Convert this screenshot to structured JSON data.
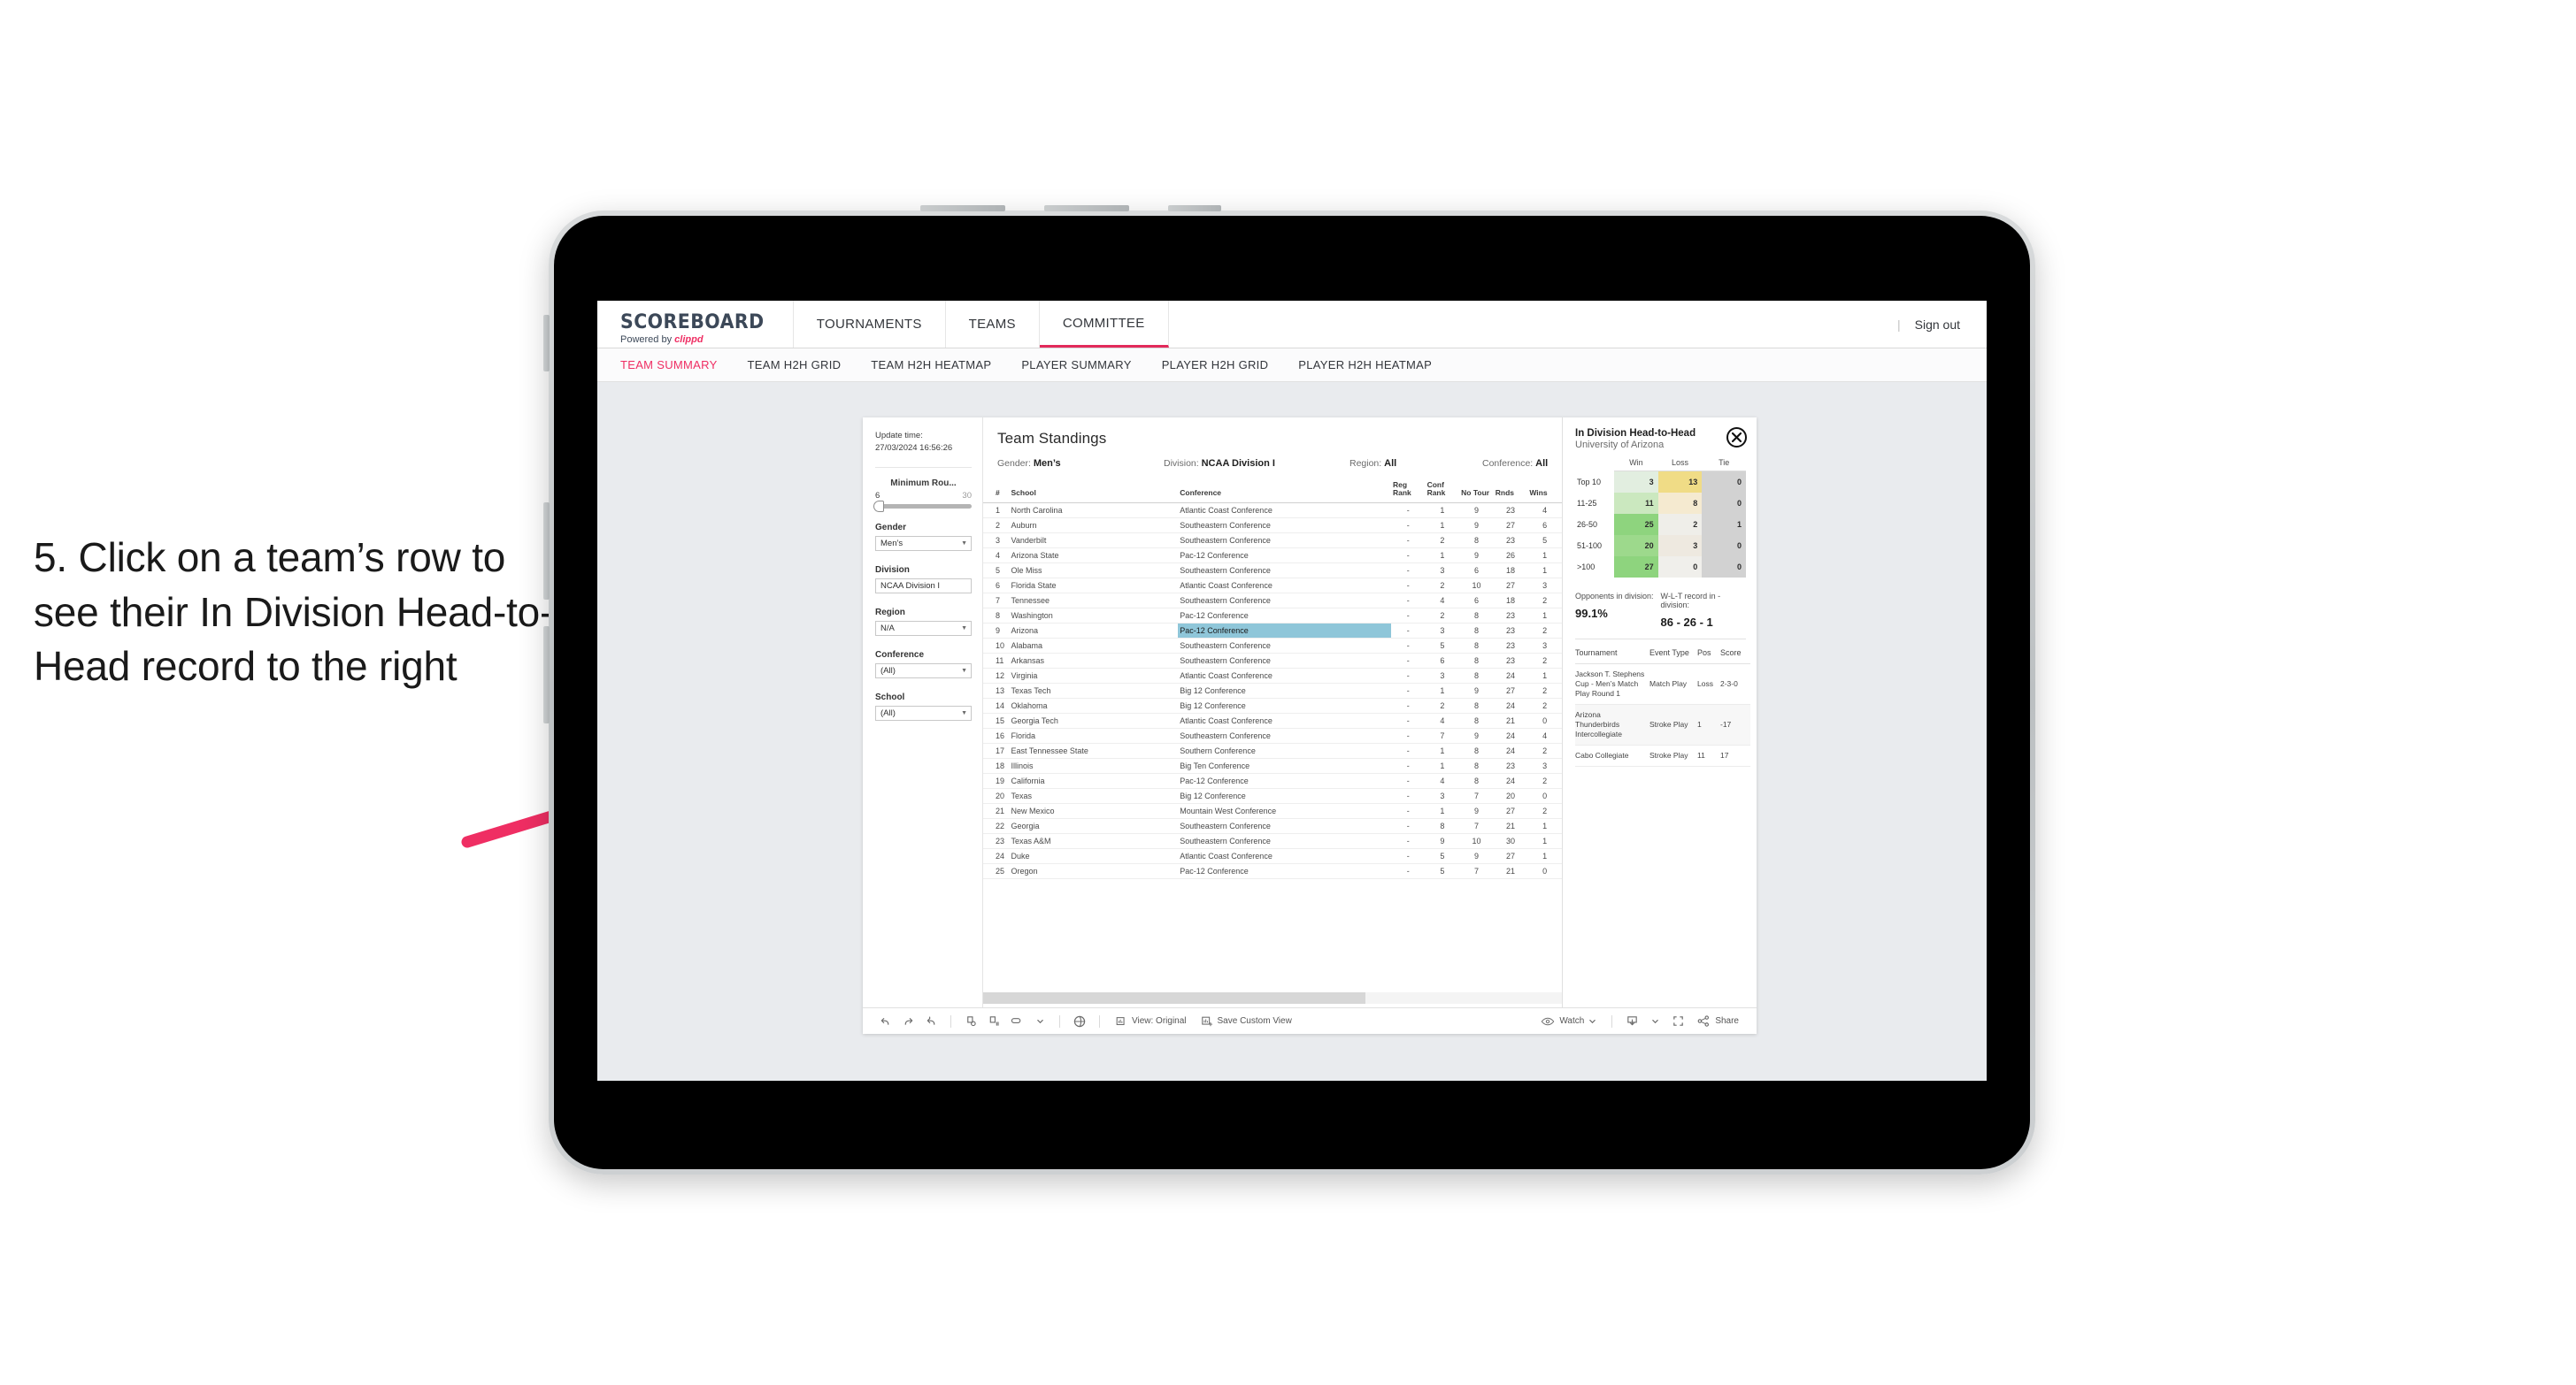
{
  "callout": {
    "text": "5. Click on a team’s row to see their In Division Head-to-Head record to the right",
    "arrow_color": "#ef2e63"
  },
  "topnav": {
    "logo_main": "SCOREBOARD",
    "logo_sub_prefix": "Powered by ",
    "logo_sub_brand": "clippd",
    "items": [
      {
        "label": "TOURNAMENTS",
        "active": false
      },
      {
        "label": "TEAMS",
        "active": false
      },
      {
        "label": "COMMITTEE",
        "active": true
      }
    ],
    "separator": "|",
    "signout": "Sign out",
    "accent": "#e22a5b"
  },
  "subnav": {
    "items": [
      {
        "label": "TEAM SUMMARY",
        "active": true
      },
      {
        "label": "TEAM H2H GRID",
        "active": false
      },
      {
        "label": "TEAM H2H HEATMAP",
        "active": false
      },
      {
        "label": "PLAYER SUMMARY",
        "active": false
      },
      {
        "label": "PLAYER H2H GRID",
        "active": false
      },
      {
        "label": "PLAYER H2H HEATMAP",
        "active": false
      }
    ]
  },
  "filters": {
    "update_time_label": "Update time:",
    "update_time_value": "27/03/2024 16:56:26",
    "slider": {
      "title": "Minimum Rou...",
      "min": "6",
      "max": "30"
    },
    "groups": [
      {
        "label": "Gender",
        "value": "Men’s"
      },
      {
        "label": "Division",
        "value": "NCAA Division I"
      },
      {
        "label": "Region",
        "value": "N/A"
      },
      {
        "label": "Conference",
        "value": "(All)"
      },
      {
        "label": "School",
        "value": "(All)"
      }
    ]
  },
  "standings": {
    "title": "Team Standings",
    "meta": [
      {
        "label": "Gender:",
        "value": "Men’s"
      },
      {
        "label": "Division:",
        "value": "NCAA Division I"
      },
      {
        "label": "Region:",
        "value": "All"
      },
      {
        "label": "Conference:",
        "value": "All"
      }
    ],
    "columns": [
      "#",
      "School",
      "Conference",
      "Reg Rank",
      "Conf Rank",
      "No Tour",
      "Rnds",
      "Wins"
    ],
    "selected_row": 9,
    "rows": [
      {
        "rank": "1",
        "school": "North Carolina",
        "conference": "Atlantic Coast Conference",
        "reg_rank": "-",
        "conf_rank": "1",
        "no_tour": "9",
        "rnds": "23",
        "wins": "4"
      },
      {
        "rank": "2",
        "school": "Auburn",
        "conference": "Southeastern Conference",
        "reg_rank": "-",
        "conf_rank": "1",
        "no_tour": "9",
        "rnds": "27",
        "wins": "6"
      },
      {
        "rank": "3",
        "school": "Vanderbilt",
        "conference": "Southeastern Conference",
        "reg_rank": "-",
        "conf_rank": "2",
        "no_tour": "8",
        "rnds": "23",
        "wins": "5"
      },
      {
        "rank": "4",
        "school": "Arizona State",
        "conference": "Pac-12 Conference",
        "reg_rank": "-",
        "conf_rank": "1",
        "no_tour": "9",
        "rnds": "26",
        "wins": "1"
      },
      {
        "rank": "5",
        "school": "Ole Miss",
        "conference": "Southeastern Conference",
        "reg_rank": "-",
        "conf_rank": "3",
        "no_tour": "6",
        "rnds": "18",
        "wins": "1"
      },
      {
        "rank": "6",
        "school": "Florida State",
        "conference": "Atlantic Coast Conference",
        "reg_rank": "-",
        "conf_rank": "2",
        "no_tour": "10",
        "rnds": "27",
        "wins": "3"
      },
      {
        "rank": "7",
        "school": "Tennessee",
        "conference": "Southeastern Conference",
        "reg_rank": "-",
        "conf_rank": "4",
        "no_tour": "6",
        "rnds": "18",
        "wins": "2"
      },
      {
        "rank": "8",
        "school": "Washington",
        "conference": "Pac-12 Conference",
        "reg_rank": "-",
        "conf_rank": "2",
        "no_tour": "8",
        "rnds": "23",
        "wins": "1"
      },
      {
        "rank": "9",
        "school": "Arizona",
        "conference": "Pac-12 Conference",
        "reg_rank": "-",
        "conf_rank": "3",
        "no_tour": "8",
        "rnds": "23",
        "wins": "2"
      },
      {
        "rank": "10",
        "school": "Alabama",
        "conference": "Southeastern Conference",
        "reg_rank": "-",
        "conf_rank": "5",
        "no_tour": "8",
        "rnds": "23",
        "wins": "3"
      },
      {
        "rank": "11",
        "school": "Arkansas",
        "conference": "Southeastern Conference",
        "reg_rank": "-",
        "conf_rank": "6",
        "no_tour": "8",
        "rnds": "23",
        "wins": "2"
      },
      {
        "rank": "12",
        "school": "Virginia",
        "conference": "Atlantic Coast Conference",
        "reg_rank": "-",
        "conf_rank": "3",
        "no_tour": "8",
        "rnds": "24",
        "wins": "1"
      },
      {
        "rank": "13",
        "school": "Texas Tech",
        "conference": "Big 12 Conference",
        "reg_rank": "-",
        "conf_rank": "1",
        "no_tour": "9",
        "rnds": "27",
        "wins": "2"
      },
      {
        "rank": "14",
        "school": "Oklahoma",
        "conference": "Big 12 Conference",
        "reg_rank": "-",
        "conf_rank": "2",
        "no_tour": "8",
        "rnds": "24",
        "wins": "2"
      },
      {
        "rank": "15",
        "school": "Georgia Tech",
        "conference": "Atlantic Coast Conference",
        "reg_rank": "-",
        "conf_rank": "4",
        "no_tour": "8",
        "rnds": "21",
        "wins": "0"
      },
      {
        "rank": "16",
        "school": "Florida",
        "conference": "Southeastern Conference",
        "reg_rank": "-",
        "conf_rank": "7",
        "no_tour": "9",
        "rnds": "24",
        "wins": "4"
      },
      {
        "rank": "17",
        "school": "East Tennessee State",
        "conference": "Southern Conference",
        "reg_rank": "-",
        "conf_rank": "1",
        "no_tour": "8",
        "rnds": "24",
        "wins": "2"
      },
      {
        "rank": "18",
        "school": "Illinois",
        "conference": "Big Ten Conference",
        "reg_rank": "-",
        "conf_rank": "1",
        "no_tour": "8",
        "rnds": "23",
        "wins": "3"
      },
      {
        "rank": "19",
        "school": "California",
        "conference": "Pac-12 Conference",
        "reg_rank": "-",
        "conf_rank": "4",
        "no_tour": "8",
        "rnds": "24",
        "wins": "2"
      },
      {
        "rank": "20",
        "school": "Texas",
        "conference": "Big 12 Conference",
        "reg_rank": "-",
        "conf_rank": "3",
        "no_tour": "7",
        "rnds": "20",
        "wins": "0"
      },
      {
        "rank": "21",
        "school": "New Mexico",
        "conference": "Mountain West Conference",
        "reg_rank": "-",
        "conf_rank": "1",
        "no_tour": "9",
        "rnds": "27",
        "wins": "2"
      },
      {
        "rank": "22",
        "school": "Georgia",
        "conference": "Southeastern Conference",
        "reg_rank": "-",
        "conf_rank": "8",
        "no_tour": "7",
        "rnds": "21",
        "wins": "1"
      },
      {
        "rank": "23",
        "school": "Texas A&M",
        "conference": "Southeastern Conference",
        "reg_rank": "-",
        "conf_rank": "9",
        "no_tour": "10",
        "rnds": "30",
        "wins": "1"
      },
      {
        "rank": "24",
        "school": "Duke",
        "conference": "Atlantic Coast Conference",
        "reg_rank": "-",
        "conf_rank": "5",
        "no_tour": "9",
        "rnds": "27",
        "wins": "1"
      },
      {
        "rank": "25",
        "school": "Oregon",
        "conference": "Pac-12 Conference",
        "reg_rank": "-",
        "conf_rank": "5",
        "no_tour": "7",
        "rnds": "21",
        "wins": "0"
      }
    ]
  },
  "h2h": {
    "title": "In Division Head-to-Head",
    "subtitle": "University of Arizona",
    "close_icon": "close-icon",
    "chart_data": {
      "type": "heatmap",
      "title": "In Division Head-to-Head",
      "subtitle": "University of Arizona",
      "columns": [
        "Win",
        "Loss",
        "Tie"
      ],
      "rows": [
        "Top 10",
        "11-25",
        "26-50",
        "51-100",
        ">100"
      ],
      "values": [
        [
          3,
          13,
          0
        ],
        [
          11,
          8,
          0
        ],
        [
          25,
          2,
          1
        ],
        [
          20,
          3,
          0
        ],
        [
          27,
          0,
          0
        ]
      ],
      "cell_colors": [
        [
          "#e2eee0",
          "#f0dc86",
          "#d2d2d2"
        ],
        [
          "#cbe8bf",
          "#f5ead0",
          "#d2d2d2"
        ],
        [
          "#8ed47e",
          "#efeee9",
          "#d2d2d2"
        ],
        [
          "#9dd98c",
          "#eee9e0",
          "#d2d2d2"
        ],
        [
          "#8ed47e",
          "#f0efeb",
          "#d2d2d2"
        ]
      ],
      "legend": "none",
      "grid": false
    },
    "stats": [
      {
        "label": "Opponents in division:",
        "value": "99.1%"
      },
      {
        "label": "W-L-T record in -division:",
        "value": "86 - 26 - 1"
      }
    ],
    "tournament_columns": [
      "Tournament",
      "Event Type",
      "Pos",
      "Score"
    ],
    "tournaments": [
      {
        "name": "Jackson T. Stephens Cup - Men’s Match Play Round 1",
        "type": "Match Play",
        "pos": "Loss",
        "score": "2-3-0"
      },
      {
        "name": "Arizona Thunderbirds Intercollegiate",
        "type": "Stroke Play",
        "pos": "1",
        "score": "-17"
      },
      {
        "name": "Cabo Collegiate",
        "type": "Stroke Play",
        "pos": "11",
        "score": "17"
      }
    ]
  },
  "toolbar": {
    "icons": [
      "undo-icon",
      "redo-icon",
      "revert-icon",
      "refresh-icon",
      "pause-icon",
      "highlight-icon"
    ],
    "view_label": "View: Original",
    "save_label": "Save Custom View",
    "watch_label": "Watch",
    "share_label": "Share",
    "download_icon": "download-icon",
    "fullscreen_icon": "fullscreen-icon",
    "share_icon": "share-icon",
    "eye_icon": "eye-icon",
    "globe_icon": "globe-icon"
  }
}
